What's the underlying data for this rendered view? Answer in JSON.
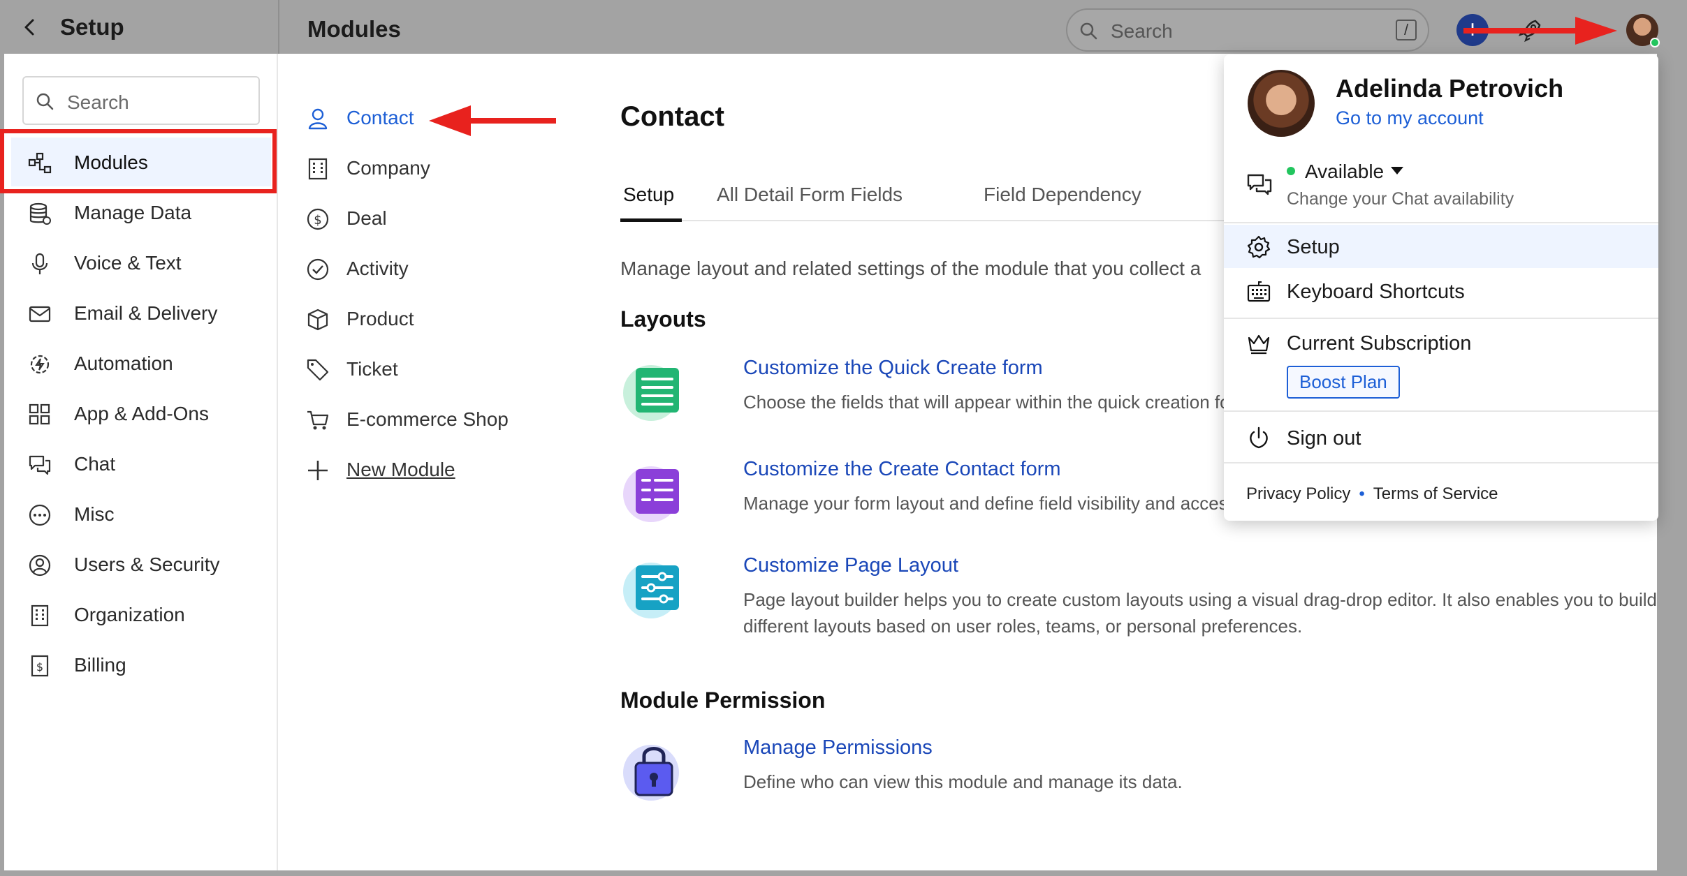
{
  "topbar": {
    "setup_title": "Setup",
    "modules_title": "Modules",
    "search_placeholder": "Search",
    "search_shortcut": "/",
    "plus_symbol": "+"
  },
  "sidebar": {
    "search_placeholder": "Search",
    "items": [
      {
        "label": "Modules",
        "icon": "modules-icon",
        "active": true
      },
      {
        "label": "Manage Data",
        "icon": "database-icon"
      },
      {
        "label": "Voice & Text",
        "icon": "microphone-icon"
      },
      {
        "label": "Email & Delivery",
        "icon": "mail-icon"
      },
      {
        "label": "Automation",
        "icon": "automation-icon"
      },
      {
        "label": "App & Add-Ons",
        "icon": "apps-grid-icon"
      },
      {
        "label": "Chat",
        "icon": "chat-icon"
      },
      {
        "label": "Misc",
        "icon": "more-icon"
      },
      {
        "label": "Users & Security",
        "icon": "user-circle-icon"
      },
      {
        "label": "Organization",
        "icon": "building-icon"
      },
      {
        "label": "Billing",
        "icon": "receipt-icon"
      }
    ]
  },
  "modules": {
    "items": [
      {
        "label": "Contact",
        "icon": "person-icon",
        "active": true
      },
      {
        "label": "Company",
        "icon": "building-icon"
      },
      {
        "label": "Deal",
        "icon": "dollar-icon"
      },
      {
        "label": "Activity",
        "icon": "check-circle-icon"
      },
      {
        "label": "Product",
        "icon": "box-icon"
      },
      {
        "label": "Ticket",
        "icon": "ticket-icon"
      },
      {
        "label": "E-commerce Shop",
        "icon": "cart-icon"
      }
    ],
    "new_module_label": "New Module"
  },
  "main": {
    "title": "Contact",
    "tabs": [
      {
        "label": "Setup",
        "active": true
      },
      {
        "label": "All Detail Form Fields"
      },
      {
        "label": "Field Dependency"
      }
    ],
    "description": "Manage layout and related settings of the module that you collect a",
    "layouts_title": "Layouts",
    "features": [
      {
        "title": "Customize the Quick Create form",
        "desc": "Choose the fields that will appear within the quick creation fo",
        "icon": "form-list-icon",
        "color": "#22b573"
      },
      {
        "title": "Customize the Create Contact form",
        "desc": "Manage your form layout and define field visibility and access",
        "icon": "form-grid-icon",
        "color": "#8b3fd9"
      },
      {
        "title": "Customize Page Layout",
        "desc": "Page layout builder helps you to create custom layouts using a visual drag-drop editor. It also enables you to build different layouts based on user roles, teams, or personal preferences.",
        "icon": "sliders-icon",
        "color": "#17a2c4"
      }
    ],
    "permission_title": "Module Permission",
    "permission": {
      "title": "Manage Permissions",
      "desc": "Define who can view this module and manage its data.",
      "icon": "lock-icon",
      "color": "#4f46e5"
    }
  },
  "dropdown": {
    "name": "Adelinda Petrovich",
    "account_link": "Go to my account",
    "availability": "Available",
    "availability_sub": "Change your Chat availability",
    "setup": "Setup",
    "shortcuts": "Keyboard Shortcuts",
    "subscription": "Current Subscription",
    "plan": "Boost Plan",
    "sign_out": "Sign out",
    "privacy": "Privacy Policy",
    "terms": "Terms of Service"
  },
  "colors": {
    "accent": "#1d5fd6",
    "highlight_red": "#e8221e",
    "status_green": "#22c55e"
  }
}
